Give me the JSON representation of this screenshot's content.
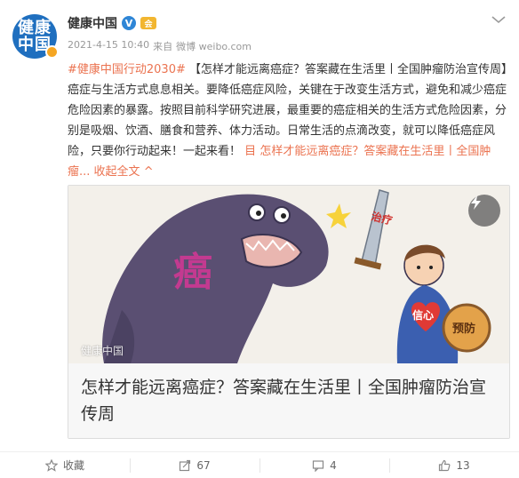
{
  "author": {
    "avatar_text_top": "健康",
    "avatar_text_bottom": "中国",
    "name": "健康中国",
    "verified_mark": "V",
    "vip_mark": "会"
  },
  "meta": {
    "datetime": "2021-4-15 10:40",
    "source_prefix": "来自",
    "source": "微博 weibo.com"
  },
  "post": {
    "hashtag": "#健康中国行动2030#",
    "text": "【怎样才能远离癌症？答案藏在生活里丨全国肿瘤防治宣传周】癌症与生活方式息息相关。要降低癌症风险，关键在于改变生活方式，避免和减少癌症危险因素的暴露。按照目前科学研究进展，最重要的癌症相关的生活方式危险因素，分别是吸烟、饮酒、膳食和营养、体力活动。日常生活的点滴改变，就可以降低癌症风险，只要你行动起来！一起来看！",
    "link_icon": "目",
    "link_text": "怎样才能远离癌症？答案藏在生活里丨全国肿瘤...",
    "collapse_label": "收起全文",
    "collapse_arrow": "^"
  },
  "card": {
    "illustration_text_cancer": "癌",
    "illustration_text_sword": "治疗",
    "illustration_text_shield": "预防",
    "illustration_text_heart": "信心",
    "watermark": "健康中国",
    "title": "怎样才能远离癌症？答案藏在生活里丨全国肿瘤防治宣传周"
  },
  "footer": {
    "favorite_label": "收藏",
    "repost_count": "67",
    "comment_count": "4",
    "like_count": "13"
  },
  "colors": {
    "link": "#eb7350",
    "avatar": "#1f6fbf",
    "monster": "#5a4f72"
  }
}
